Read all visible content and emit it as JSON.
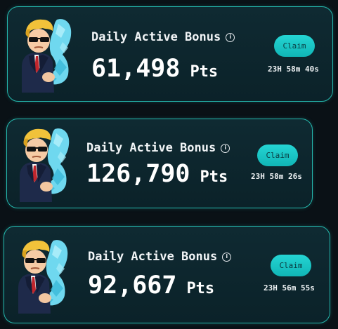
{
  "cards": [
    {
      "title": "Daily Active Bonus",
      "info_symbol": "i",
      "amount": "61,498",
      "unit": "Pts",
      "claim_label": "Claim",
      "timer": "23H 58m 40s"
    },
    {
      "title": "Daily Active Bonus",
      "info_symbol": "i",
      "amount": "126,790",
      "unit": "Pts",
      "claim_label": "Claim",
      "timer": "23H 58m 26s"
    },
    {
      "title": "Daily Active Bonus",
      "info_symbol": "i",
      "amount": "92,667",
      "unit": "Pts",
      "claim_label": "Claim",
      "timer": "23H 56m 55s"
    }
  ],
  "icons": {
    "mascot": "flexing-mascot-icon",
    "info": "info-icon"
  },
  "colors": {
    "background": "#0a1116",
    "card_border": "#25b8ae",
    "card_fill": "#0f2a32",
    "claim_button": "#1ec6c5",
    "text": "#ffffff"
  }
}
